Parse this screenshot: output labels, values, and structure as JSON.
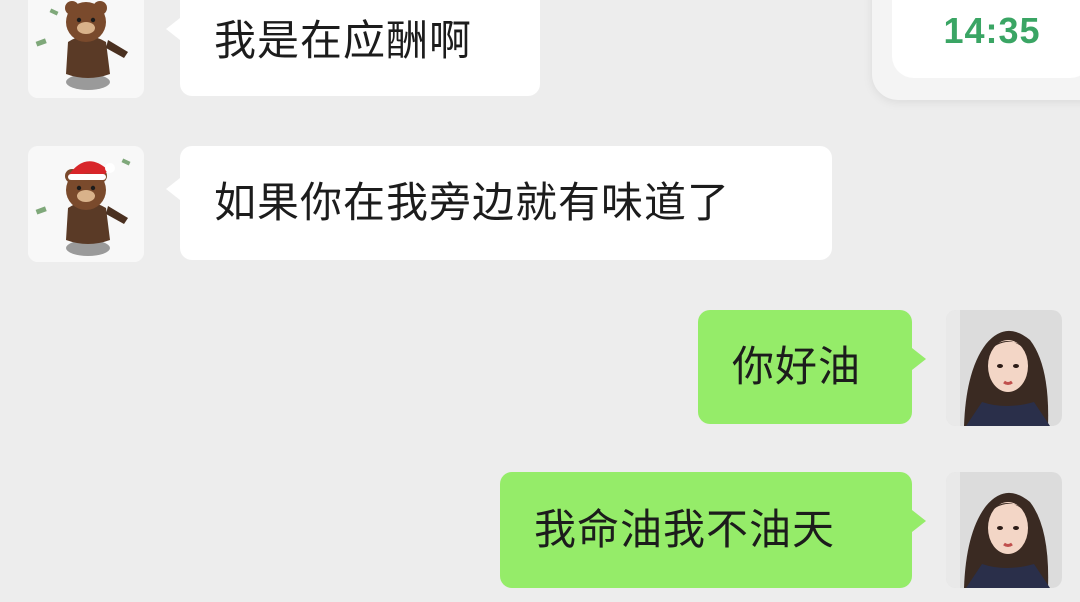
{
  "time_display": "14:35",
  "messages": [
    {
      "side": "in",
      "text": "我是在应酬啊",
      "avatar": "bear-avatar"
    },
    {
      "side": "in",
      "text": "如果你在我旁边就有味道了",
      "avatar": "bear-santa-avatar"
    },
    {
      "side": "out",
      "text": "你好油",
      "avatar": "girl-avatar"
    },
    {
      "side": "out",
      "text": "我命油我不油天",
      "avatar": "girl-avatar"
    }
  ],
  "colors": {
    "background": "#ededed",
    "incoming_bubble": "#ffffff",
    "outgoing_bubble": "#95ec69",
    "time_text": "#3aa564"
  }
}
